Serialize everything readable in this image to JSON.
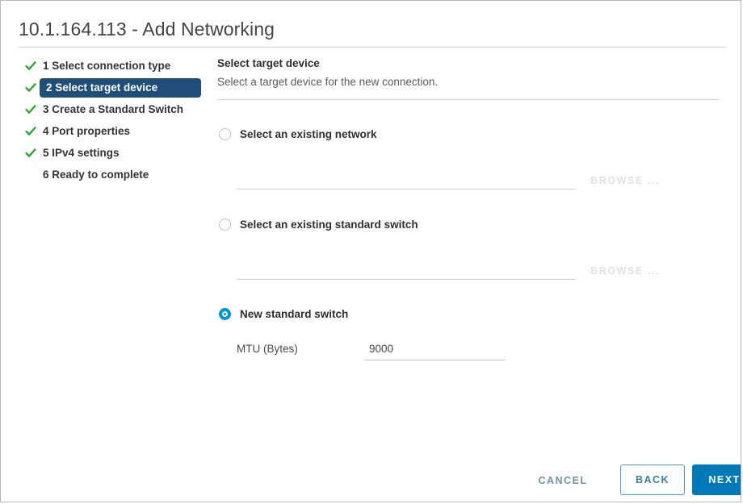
{
  "window": {
    "title": "10.1.164.113 - Add Networking"
  },
  "wizard": {
    "steps": [
      {
        "label": "1 Select connection type",
        "completed": true,
        "active": false
      },
      {
        "label": "2 Select target device",
        "completed": true,
        "active": true
      },
      {
        "label": "3 Create a Standard Switch",
        "completed": true,
        "active": false
      },
      {
        "label": "4 Port properties",
        "completed": true,
        "active": false
      },
      {
        "label": "5 IPv4 settings",
        "completed": true,
        "active": false
      },
      {
        "label": "6 Ready to complete",
        "completed": false,
        "active": false
      }
    ]
  },
  "content": {
    "title": "Select target device",
    "subtitle": "Select a target device for the new connection."
  },
  "options": {
    "existing_network": {
      "label": "Select an existing network",
      "selected": false,
      "value": "",
      "browse_label": "BROWSE ..."
    },
    "existing_switch": {
      "label": "Select an existing standard switch",
      "selected": false,
      "value": "",
      "browse_label": "BROWSE ..."
    },
    "new_switch": {
      "label": "New standard switch",
      "selected": true
    }
  },
  "mtu": {
    "label": "MTU (Bytes)",
    "value": "9000"
  },
  "footer": {
    "cancel_label": "CANCEL",
    "back_label": "BACK",
    "next_label": "NEXT"
  },
  "colors": {
    "active_step_bg": "#1e4e79",
    "check_green": "#2ea832",
    "accent_blue": "#0079b8",
    "radio_blue": "#0095d3",
    "cancel_text": "#6c93a8",
    "disabled_text": "#e2e2e2"
  }
}
